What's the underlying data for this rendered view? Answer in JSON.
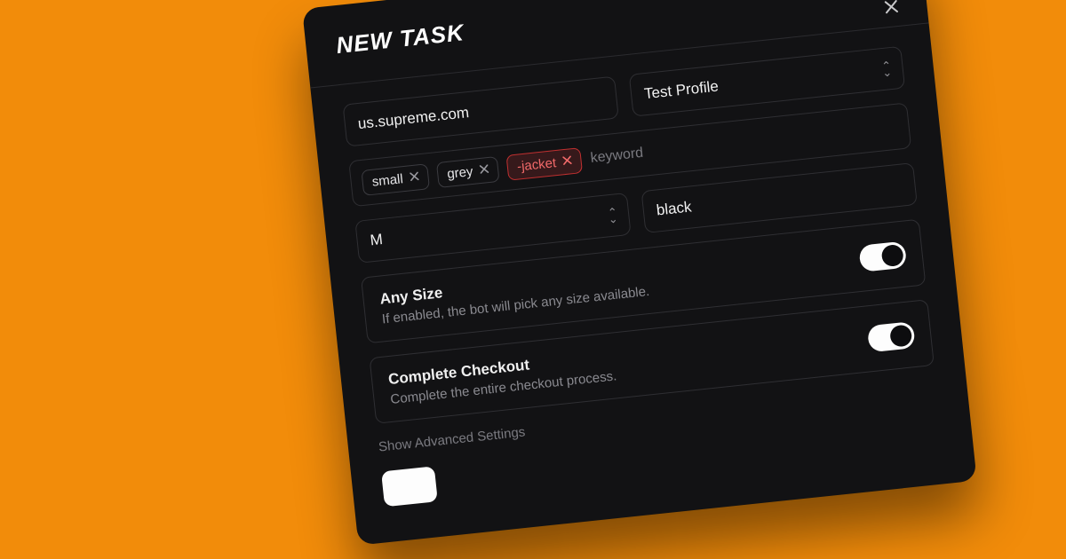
{
  "header": {
    "title": "NEW TASK",
    "close_icon": "close"
  },
  "site_field": {
    "value": "us.supreme.com"
  },
  "profile_select": {
    "value": "Test Profile"
  },
  "keywords": {
    "tags": [
      {
        "label": "small",
        "negative": false
      },
      {
        "label": "grey",
        "negative": false
      },
      {
        "label": "-jacket",
        "negative": true
      }
    ],
    "placeholder": "keyword"
  },
  "size_select": {
    "value": "M"
  },
  "color_field": {
    "value": "black"
  },
  "options": {
    "any_size": {
      "title": "Any Size",
      "desc": "If enabled, the bot will pick any size available.",
      "enabled": true
    },
    "complete_checkout": {
      "title": "Complete Checkout",
      "desc": "Complete the entire checkout process.",
      "enabled": true
    }
  },
  "advanced_link": "Show Advanced Settings"
}
